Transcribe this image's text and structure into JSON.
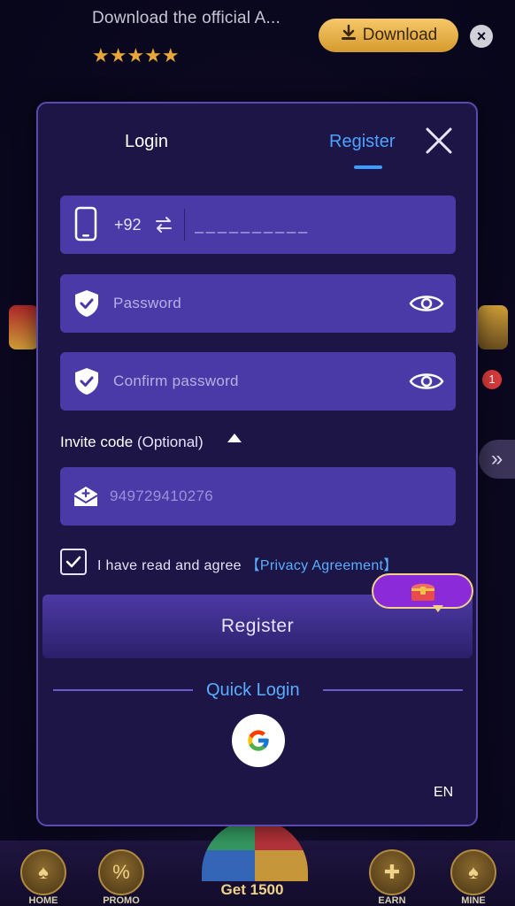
{
  "banner": {
    "text": "Download the official A...",
    "stars": "★★★★★",
    "download_label": "Download",
    "close_glyph": "×"
  },
  "background": {
    "notice_count": "1",
    "side_arrow": "»",
    "bottom_nav": [
      {
        "label": "HOME",
        "icon": "home-icon"
      },
      {
        "label": "PROMO",
        "icon": "promo-icon"
      },
      {
        "label": "EARN",
        "icon": "earn-icon"
      },
      {
        "label": "MINE",
        "icon": "mine-icon"
      }
    ],
    "wheel_label": "Get 1500"
  },
  "modal": {
    "tabs": {
      "login": "Login",
      "register": "Register",
      "active": "register"
    },
    "phone": {
      "country_code": "+92",
      "placeholder": "__________"
    },
    "password": {
      "placeholder": "Password"
    },
    "confirm_password": {
      "placeholder": "Confirm password"
    },
    "invite": {
      "label": "Invite code",
      "optional": "(Optional)",
      "placeholder": "949729410276"
    },
    "agreement": {
      "checked": true,
      "text": "I have read and agree ",
      "link": "【Privacy Agreement】"
    },
    "register_button": "Register",
    "quick_login": "Quick Login",
    "language": "EN"
  },
  "colors": {
    "accent_blue": "#4da3ff",
    "field_bg": "#4a3aa8",
    "modal_bg": "#1c1546",
    "download_gold": "#e8b44a"
  }
}
